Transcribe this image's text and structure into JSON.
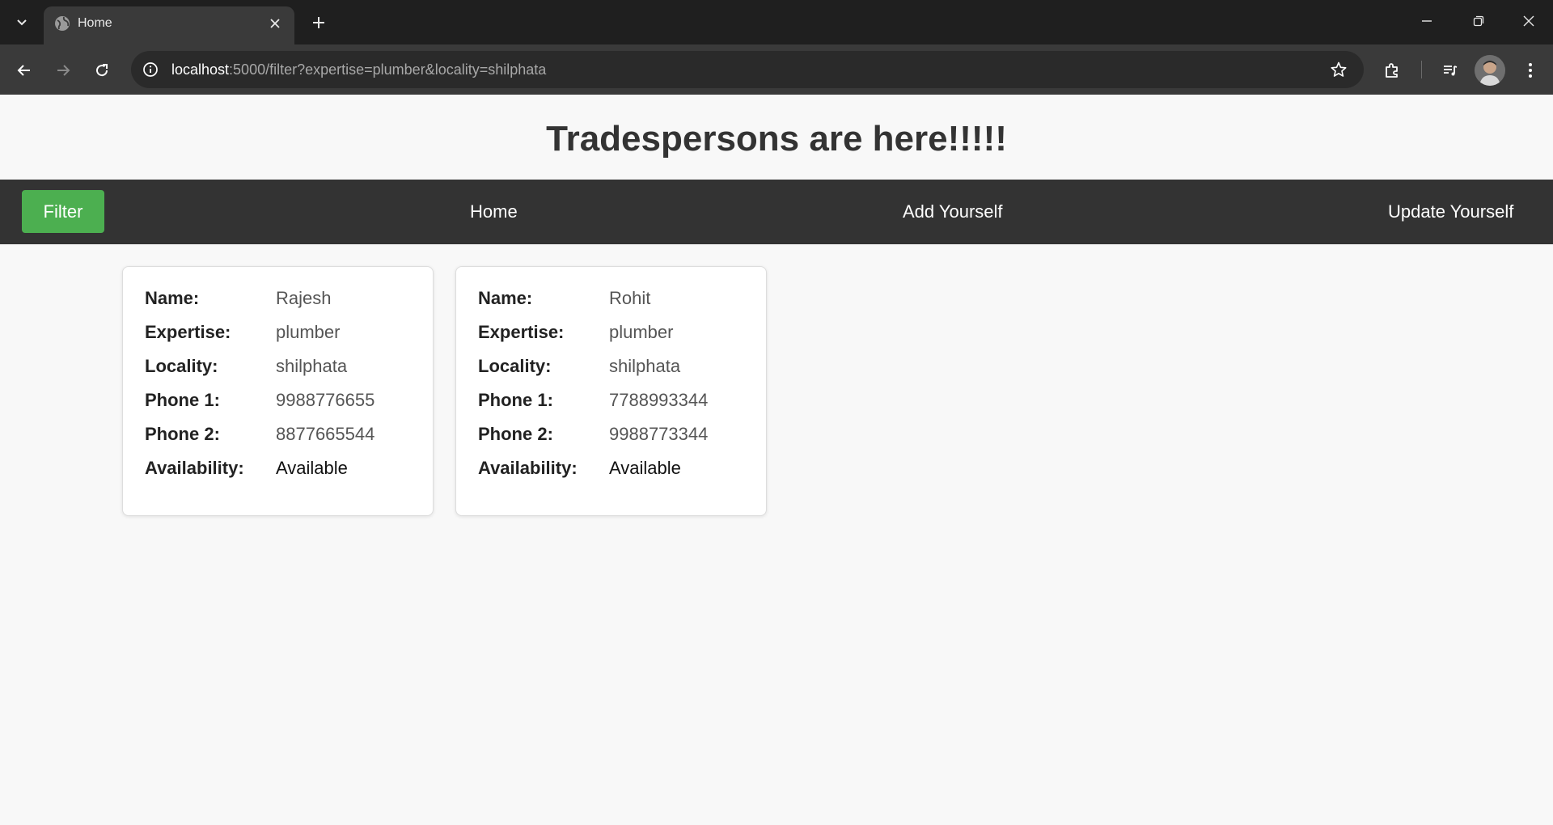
{
  "browser": {
    "tab_title": "Home",
    "url_host": "localhost",
    "url_rest": ":5000/filter?expertise=plumber&locality=shilphata",
    "icons": [
      "tab-list-icon",
      "globe-icon",
      "close-icon",
      "plus-icon",
      "minimize-icon",
      "restore-icon",
      "window-close-icon",
      "back-icon",
      "forward-icon",
      "reload-icon",
      "info-icon",
      "star-icon",
      "extensions-icon",
      "media-controls-icon",
      "profile-avatar",
      "kebab-menu-icon"
    ]
  },
  "header": {
    "title": "Tradespersons are here!!!!!"
  },
  "nav": {
    "filter_label": "Filter",
    "home_label": "Home",
    "add_label": "Add Yourself",
    "update_label": "Update Yourself"
  },
  "labels": {
    "name": "Name:",
    "expertise": "Expertise:",
    "locality": "Locality:",
    "phone1": "Phone 1:",
    "phone2": "Phone 2:",
    "availability": "Availability:"
  },
  "cards": [
    {
      "name": "Rajesh",
      "expertise": "plumber",
      "locality": "shilphata",
      "phone1": "9988776655",
      "phone2": "8877665544",
      "availability": "Available"
    },
    {
      "name": "Rohit",
      "expertise": "plumber",
      "locality": "shilphata",
      "phone1": "7788993344",
      "phone2": "9988773344",
      "availability": "Available"
    }
  ],
  "colors": {
    "accent_green": "#4caf50",
    "navbar_bg": "#333333",
    "page_bg": "#f8f8f8"
  }
}
